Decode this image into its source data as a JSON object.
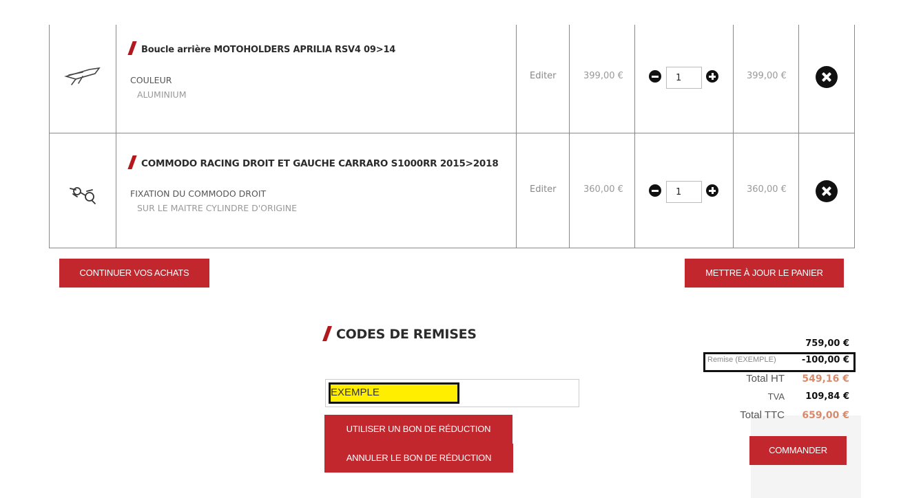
{
  "cart": {
    "items": [
      {
        "title": "Boucle arrière MOTOHOLDERS APRILIA RSV4 09>14",
        "option_name": "COULEUR",
        "option_value": "ALUMINIUM",
        "edit_label": "Editer",
        "unit_price": "399,00 €",
        "quantity": "1",
        "total": "399,00 €",
        "thumbnail_icon": "rear-hook-part-icon"
      },
      {
        "title": "COMMODO RACING DROIT ET GAUCHE CARRARO S1000RR 2015>2018",
        "option_name": "FIXATION DU COMMODO DROIT",
        "option_value": "SUR LE MAITRE CYLINDRE D'ORIGINE",
        "edit_label": "Editer",
        "unit_price": "360,00 €",
        "quantity": "1",
        "total": "360,00 €",
        "thumbnail_icon": "switch-control-part-icon"
      }
    ],
    "continue_label": "CONTINUER VOS ACHATS",
    "update_label": "METTRE À JOUR LE PANIER"
  },
  "discount": {
    "title": "CODES DE REMISES",
    "code_value": "EXEMPLE",
    "apply_label": "UTILISER UN BON DE RÉDUCTION",
    "cancel_label": "ANNULER LE BON DE RÉDUCTION"
  },
  "totals": {
    "subtotal": "759,00 €",
    "discount_label": "Remise (EXEMPLE)",
    "discount_value": "-100,00 €",
    "ht_label": "Total HT",
    "ht_value": "549,16 €",
    "tva_label": "TVA",
    "tva_value": "109,84 €",
    "ttc_label": "Total TTC",
    "ttc_value": "659,00 €",
    "order_label": "COMMANDER"
  },
  "colors": {
    "accent_red": "#c1272d",
    "highlight_yellow": "#ffee00",
    "price_orange": "#d98a6b"
  }
}
